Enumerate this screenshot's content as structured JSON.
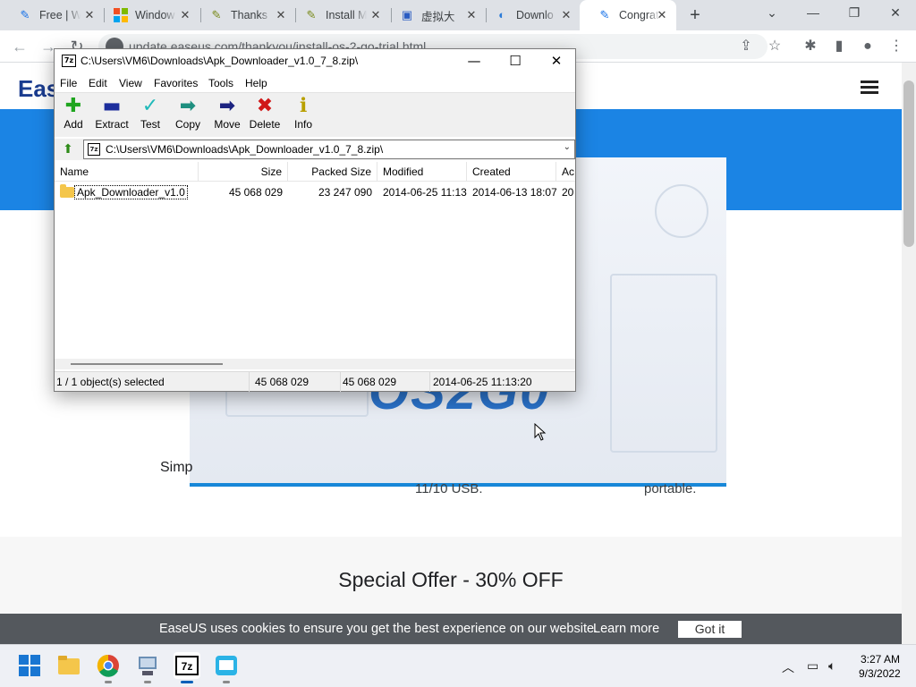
{
  "browser": {
    "tabs": [
      {
        "label": "Free | W",
        "favicon": "easeus-icon",
        "active": false
      },
      {
        "label": "Window",
        "favicon": "windows-icon",
        "active": false
      },
      {
        "label": "Thanks",
        "favicon": "sevenzip-web-icon",
        "active": false
      },
      {
        "label": "Install M",
        "favicon": "sevenzip-web-icon",
        "active": false
      },
      {
        "label": "虚拟大",
        "favicon": "vm-icon",
        "active": false
      },
      {
        "label": "Downlo",
        "favicon": "edge-icon",
        "active": false
      },
      {
        "label": "Congrat",
        "favicon": "easeus-icon",
        "active": true
      }
    ],
    "url": "update.easeus.com/thankyou/install-os-2-go-trial.html"
  },
  "page": {
    "brand": "Eas",
    "logo_text": "OS2G0",
    "simple_text": "Simp",
    "feature_a": "11/10 USB.",
    "feature_b": "portable.",
    "offer": "Special Offer - 30% OFF",
    "cookie": {
      "text": "EaseUS uses cookies to ensure you get the best experience on our website.",
      "learn_more": "Learn more",
      "got_it": "Got it"
    }
  },
  "zip": {
    "title": "C:\\Users\\VM6\\Downloads\\Apk_Downloader_v1.0_7_8.zip\\",
    "app_icon_text": "7z",
    "menu": [
      "File",
      "Edit",
      "View",
      "Favorites",
      "Tools",
      "Help"
    ],
    "toolbar": [
      {
        "label": "Add",
        "icon": "plus-icon",
        "color": "#1fa51f",
        "glyph": "✚"
      },
      {
        "label": "Extract",
        "icon": "minus-icon",
        "color": "#1c2d9c",
        "glyph": "▬"
      },
      {
        "label": "Test",
        "icon": "check-icon",
        "color": "#1fb9b9",
        "glyph": "✓"
      },
      {
        "label": "Copy",
        "icon": "copy-arrow-icon",
        "color": "#1e8f7f",
        "glyph": "➡"
      },
      {
        "label": "Move",
        "icon": "move-arrow-icon",
        "color": "#1c2380",
        "glyph": "➡"
      },
      {
        "label": "Delete",
        "icon": "delete-x-icon",
        "color": "#d01818",
        "glyph": "✖"
      },
      {
        "label": "Info",
        "icon": "info-icon",
        "color": "#b9a000",
        "glyph": "ℹ"
      }
    ],
    "address": "C:\\Users\\VM6\\Downloads\\Apk_Downloader_v1.0_7_8.zip\\",
    "columns": [
      "Name",
      "Size",
      "Packed Size",
      "Modified",
      "Created",
      "Ac"
    ],
    "rows": [
      {
        "name": "Apk_Downloader_v1.0",
        "size": "45 068 029",
        "packed": "23 247 090",
        "modified": "2014-06-25 11:13",
        "created": "2014-06-13 18:07",
        "accessed": "20"
      }
    ],
    "status": {
      "selected": "1 / 1 object(s) selected",
      "size": "45 068 029",
      "packed": "45 068 029",
      "modified": "2014-06-25 11:13:20"
    }
  },
  "taskbar": {
    "apps": [
      "start-icon",
      "file-explorer-icon",
      "chrome-icon",
      "vm-app-icon",
      "sevenzip-icon",
      "os2go-icon"
    ],
    "time": "3:27 AM",
    "date": "9/3/2022"
  }
}
